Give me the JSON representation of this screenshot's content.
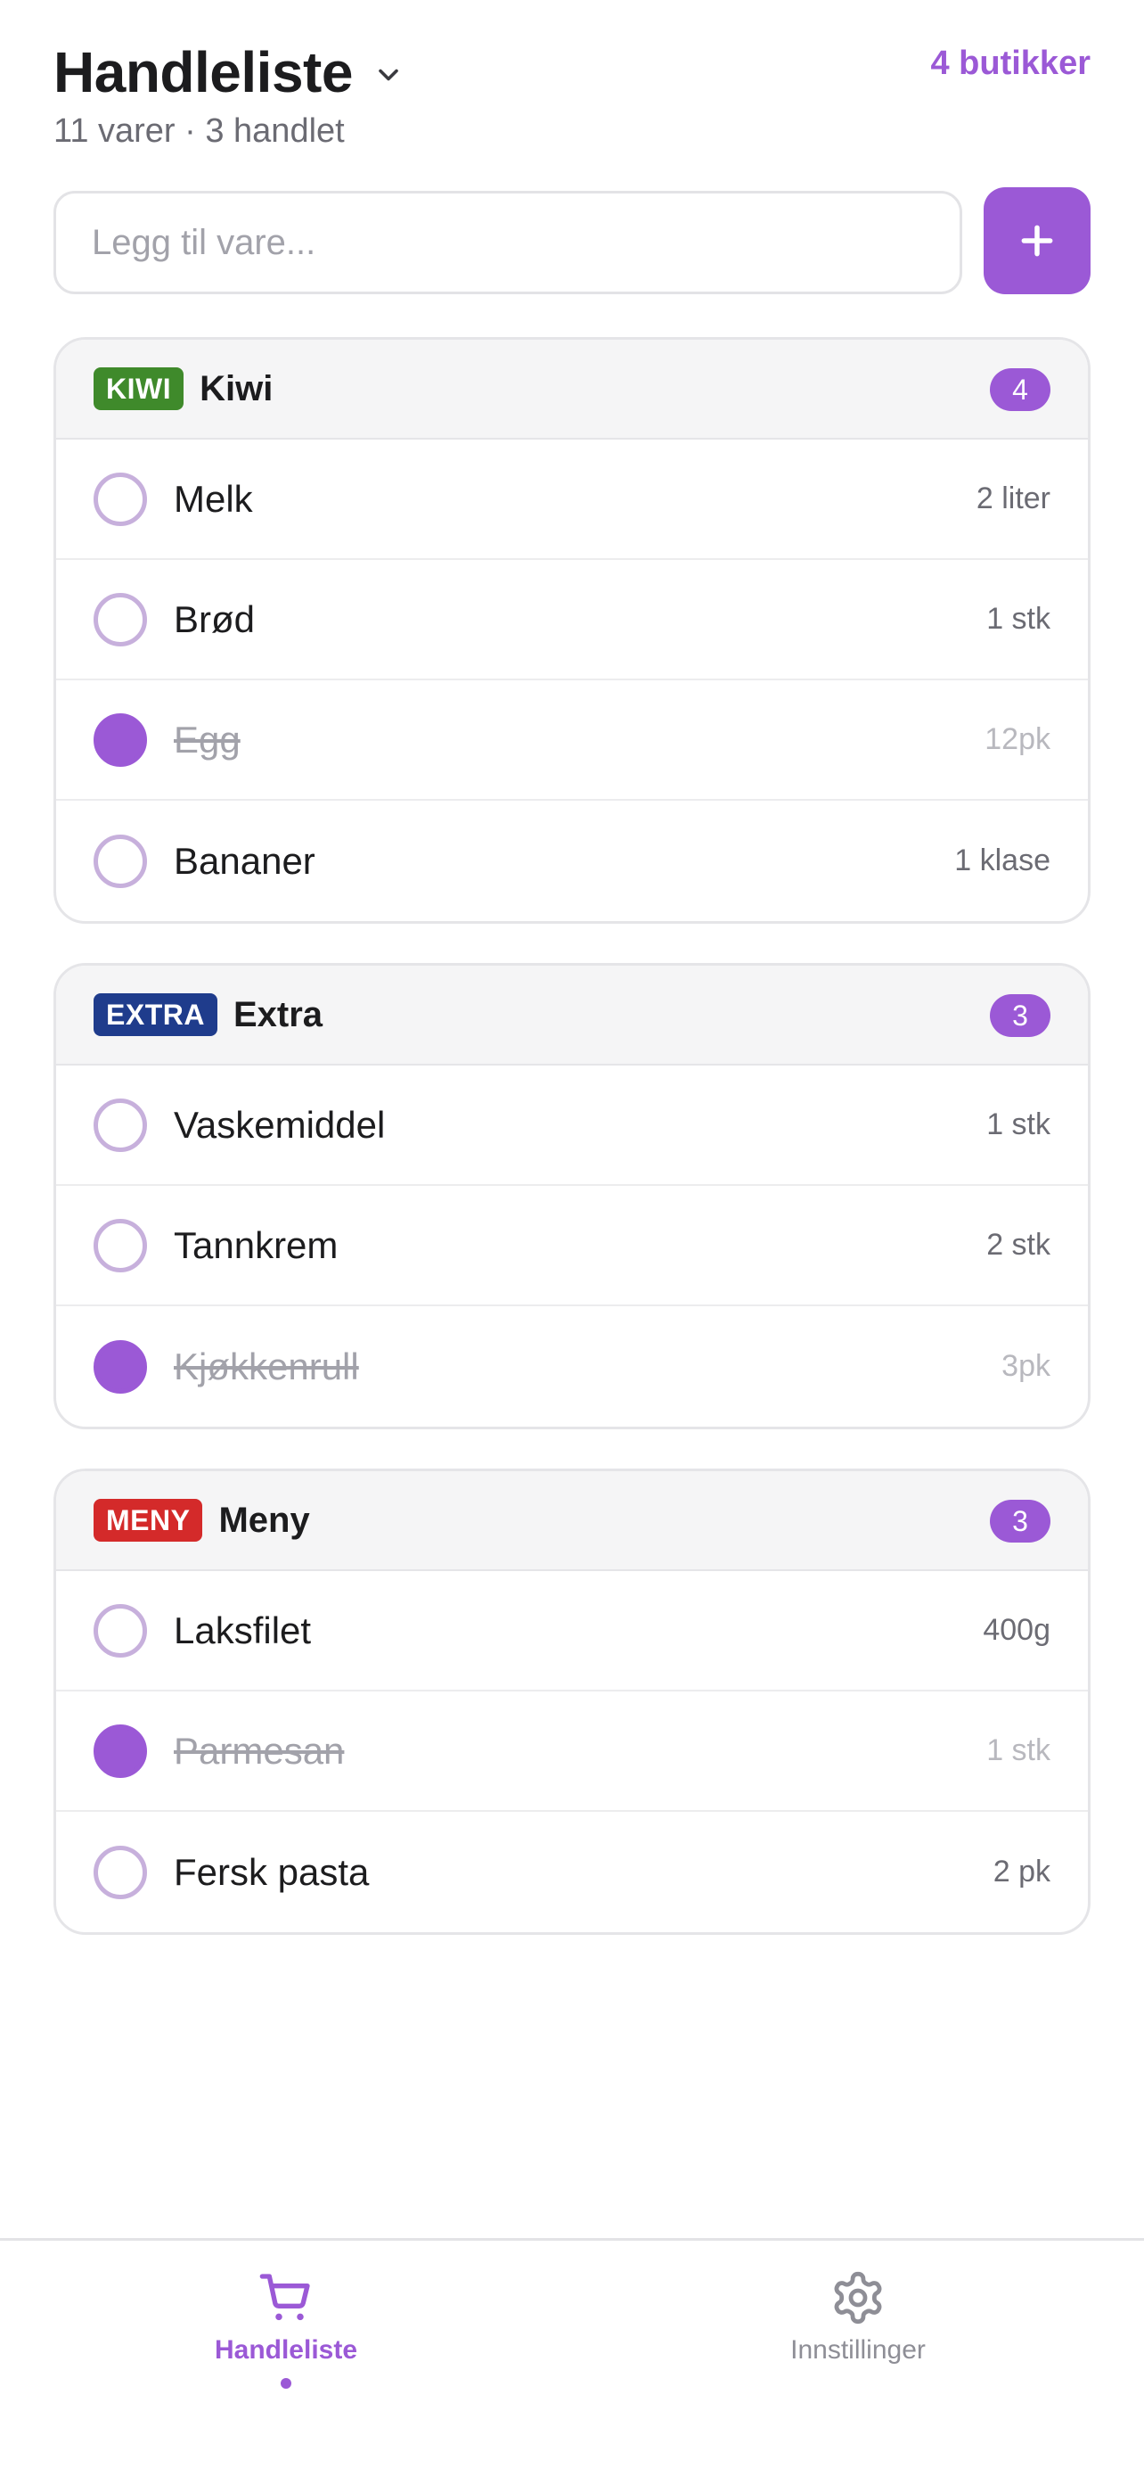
{
  "header": {
    "title": "Handleliste",
    "subtitle": "11 varer · 3 handlet",
    "stores_link": "4 butikker"
  },
  "add": {
    "placeholder": "Legg til vare...",
    "button_icon": "plus-icon"
  },
  "stores": [
    {
      "badge": "KIWI",
      "badge_color": "#3f8a2b",
      "name": "Kiwi",
      "count": "4",
      "items": [
        {
          "name": "Melk",
          "qty": "2 liter",
          "done": false
        },
        {
          "name": "Brød",
          "qty": "1 stk",
          "done": false
        },
        {
          "name": "Egg",
          "qty": "12pk",
          "done": true
        },
        {
          "name": "Bananer",
          "qty": "1 klase",
          "done": false
        }
      ]
    },
    {
      "badge": "EXTRA",
      "badge_color": "#1f3c8c",
      "name": "Extra",
      "count": "3",
      "items": [
        {
          "name": "Vaskemiddel",
          "qty": "1 stk",
          "done": false
        },
        {
          "name": "Tannkrem",
          "qty": "2 stk",
          "done": false
        },
        {
          "name": "Kjøkkenrull",
          "qty": "3pk",
          "done": true
        }
      ]
    },
    {
      "badge": "MENY",
      "badge_color": "#d42a2a",
      "name": "Meny",
      "count": "3",
      "items": [
        {
          "name": "Laksfilet",
          "qty": "400g",
          "done": false
        },
        {
          "name": "Parmesan",
          "qty": "1 stk",
          "done": true
        },
        {
          "name": "Fersk pasta",
          "qty": "2 pk",
          "done": false
        }
      ]
    }
  ],
  "tabs": [
    {
      "label": "Handleliste",
      "icon": "cart-icon",
      "active": true
    },
    {
      "label": "Innstillinger",
      "icon": "gear-icon",
      "active": false
    }
  ],
  "colors": {
    "accent": "#9b59d6",
    "unchecked_ring": "#c7b0dc"
  }
}
